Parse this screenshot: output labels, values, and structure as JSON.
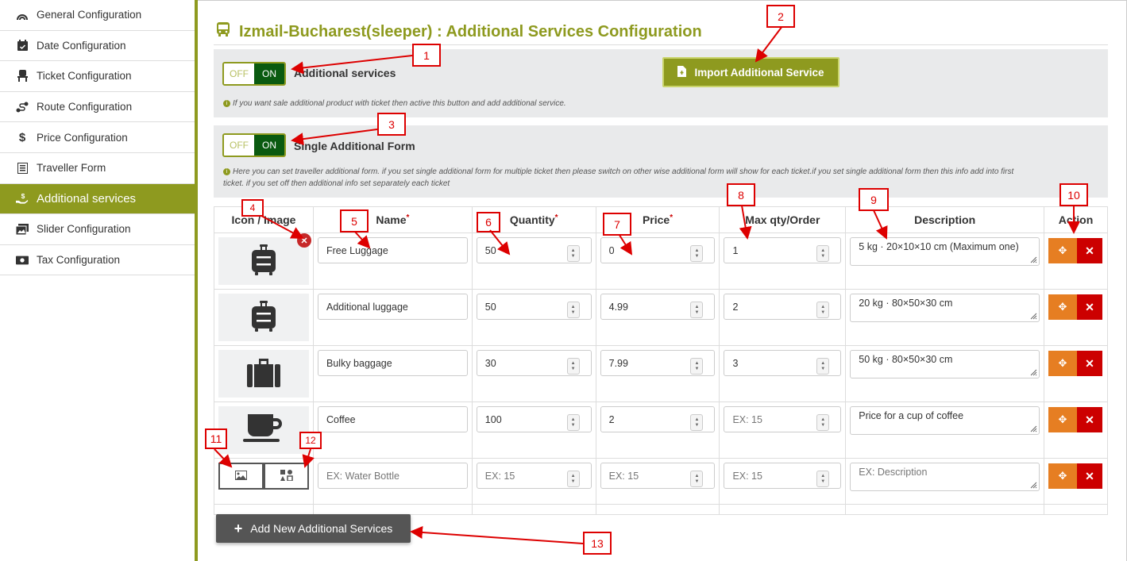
{
  "sidebar": {
    "items": [
      {
        "label": "General Configuration",
        "icon": "rainbow-icon"
      },
      {
        "label": "Date Configuration",
        "icon": "calendar-check-icon"
      },
      {
        "label": "Ticket Configuration",
        "icon": "chair-icon"
      },
      {
        "label": "Route Configuration",
        "icon": "route-icon"
      },
      {
        "label": "Price Configuration",
        "icon": "dollar-icon"
      },
      {
        "label": "Traveller Form",
        "icon": "form-icon"
      },
      {
        "label": "Additional services",
        "icon": "hand-holding-dollar-icon",
        "active": true
      },
      {
        "label": "Slider Configuration",
        "icon": "images-icon"
      },
      {
        "label": "Tax Configuration",
        "icon": "money-bill-icon"
      }
    ]
  },
  "page": {
    "title": "Izmail-Bucharest(sleeper) : Additional Services Configuration"
  },
  "additional_services": {
    "off": "OFF",
    "on": "ON",
    "label": "Additional services",
    "note": "If you want sale additional product with ticket then active this button and add additional service."
  },
  "import_button": "Import Additional Service",
  "single_form": {
    "off": "OFF",
    "on": "ON",
    "label": "Single Additional Form",
    "note1": "Here you can set traveller additional form. if you set single additional form for multiple ticket then please switch on other wise additional form will show for each ticket.if you set single additional form then this info add into first",
    "note2": "ticket. if you set off then additional info set separately each ticket"
  },
  "table": {
    "headers": {
      "icon": "Icon / Image",
      "name": "Name",
      "quantity": "Quantity",
      "price": "Price",
      "max": "Max qty/Order",
      "description": "Description",
      "action": "Action",
      "req": "*"
    },
    "rows": [
      {
        "icon": "suitcase-rolling-icon",
        "name": "Free Luggage",
        "quantity": "50",
        "price": "0",
        "max": "1",
        "description": "5 kg · 20×10×10 cm (Maximum one)"
      },
      {
        "icon": "suitcase-rolling-icon",
        "name": "Additional luggage",
        "quantity": "50",
        "price": "4.99",
        "max": "2",
        "description": "20 kg · 80×50×30 cm"
      },
      {
        "icon": "suitcase-icon",
        "name": "Bulky baggage",
        "quantity": "30",
        "price": "7.99",
        "max": "3",
        "description": "50 kg · 80×50×30 cm"
      },
      {
        "icon": "coffee-cup-icon",
        "name": "Coffee",
        "quantity": "100",
        "price": "2",
        "max_placeholder": "EX: 15",
        "description": "Price for a cup of coffee"
      }
    ],
    "new_row": {
      "name_placeholder": "EX: Water Bottle",
      "quantity_placeholder": "EX: 15",
      "price_placeholder": "EX: 15",
      "max_placeholder": "EX: 15",
      "description_placeholder": "EX: Description"
    }
  },
  "add_button": "Add New Additional Services",
  "callouts": [
    "1",
    "2",
    "3",
    "4",
    "5",
    "6",
    "7",
    "8",
    "9",
    "10",
    "11",
    "12",
    "13"
  ],
  "colors": {
    "accent": "#8e9a1f",
    "toggle_on": "#0a5a10",
    "move": "#e67e22",
    "delete": "#cc0000",
    "callout": "#dd0000"
  }
}
